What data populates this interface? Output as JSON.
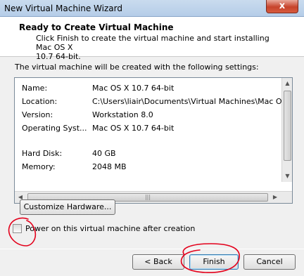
{
  "window": {
    "title": "New Virtual Machine Wizard",
    "close_label": "x"
  },
  "header": {
    "title": "Ready to Create Virtual Machine",
    "description_line1": "Click Finish to create the virtual machine and start installing Mac OS X",
    "description_line2": "10.7 64-bit."
  },
  "intro": "The virtual machine will be created with the following settings:",
  "settings": [
    {
      "key": "Name:",
      "value": "Mac OS X 10.7 64-bit"
    },
    {
      "key": "Location:",
      "value": "C:\\Users\\liair\\Documents\\Virtual Machines\\Mac OS"
    },
    {
      "key": "Version:",
      "value": "Workstation 8.0"
    },
    {
      "key": "Operating Syst...",
      "value": "Mac OS X 10.7 64-bit"
    },
    {
      "key": "Hard Disk:",
      "value": "40 GB"
    },
    {
      "key": "Memory:",
      "value": "2048 MB"
    }
  ],
  "customize_label": "Customize Hardware...",
  "power_on": {
    "label": "Power on this virtual machine after creation",
    "checked": false
  },
  "buttons": {
    "back": "< Back",
    "finish": "Finish",
    "cancel": "Cancel"
  },
  "colors": {
    "annotation": "#e3001b",
    "titlebar": "#b9d1ea"
  }
}
